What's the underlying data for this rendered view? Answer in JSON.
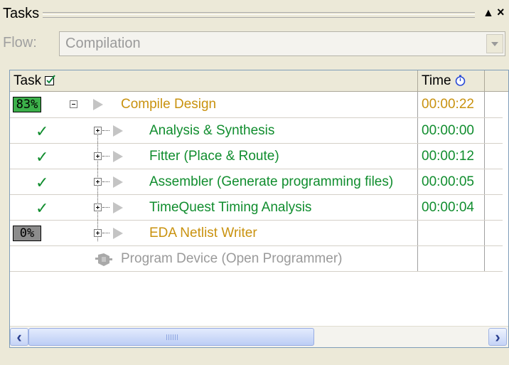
{
  "window": {
    "title": "Tasks",
    "pin_glyph": "▲",
    "close_glyph": "×"
  },
  "flow": {
    "label": "Flow:",
    "value": "Compilation"
  },
  "columns": {
    "task": "Task",
    "time": "Time"
  },
  "tasks": [
    {
      "status": "83%",
      "name": "Compile Design",
      "time": "00:00:22"
    },
    {
      "status": "✓",
      "name": "Analysis & Synthesis",
      "time": "00:00:00"
    },
    {
      "status": "✓",
      "name": "Fitter (Place & Route)",
      "time": "00:00:12"
    },
    {
      "status": "✓",
      "name": "Assembler (Generate programming files)",
      "time": "00:00:05"
    },
    {
      "status": "✓",
      "name": "TimeQuest Timing Analysis",
      "time": "00:00:04"
    },
    {
      "status": "0%",
      "name": "EDA Netlist Writer",
      "time": ""
    },
    {
      "status": "",
      "name": "Program Device (Open Programmer)",
      "time": ""
    }
  ],
  "scrollbar": {
    "left_glyph": "‹",
    "right_glyph": "›"
  },
  "colors": {
    "done": "#108d2e",
    "in_progress": "#c9920f",
    "disabled": "#9a9a9a",
    "progress_fill": "#3cb04a"
  }
}
